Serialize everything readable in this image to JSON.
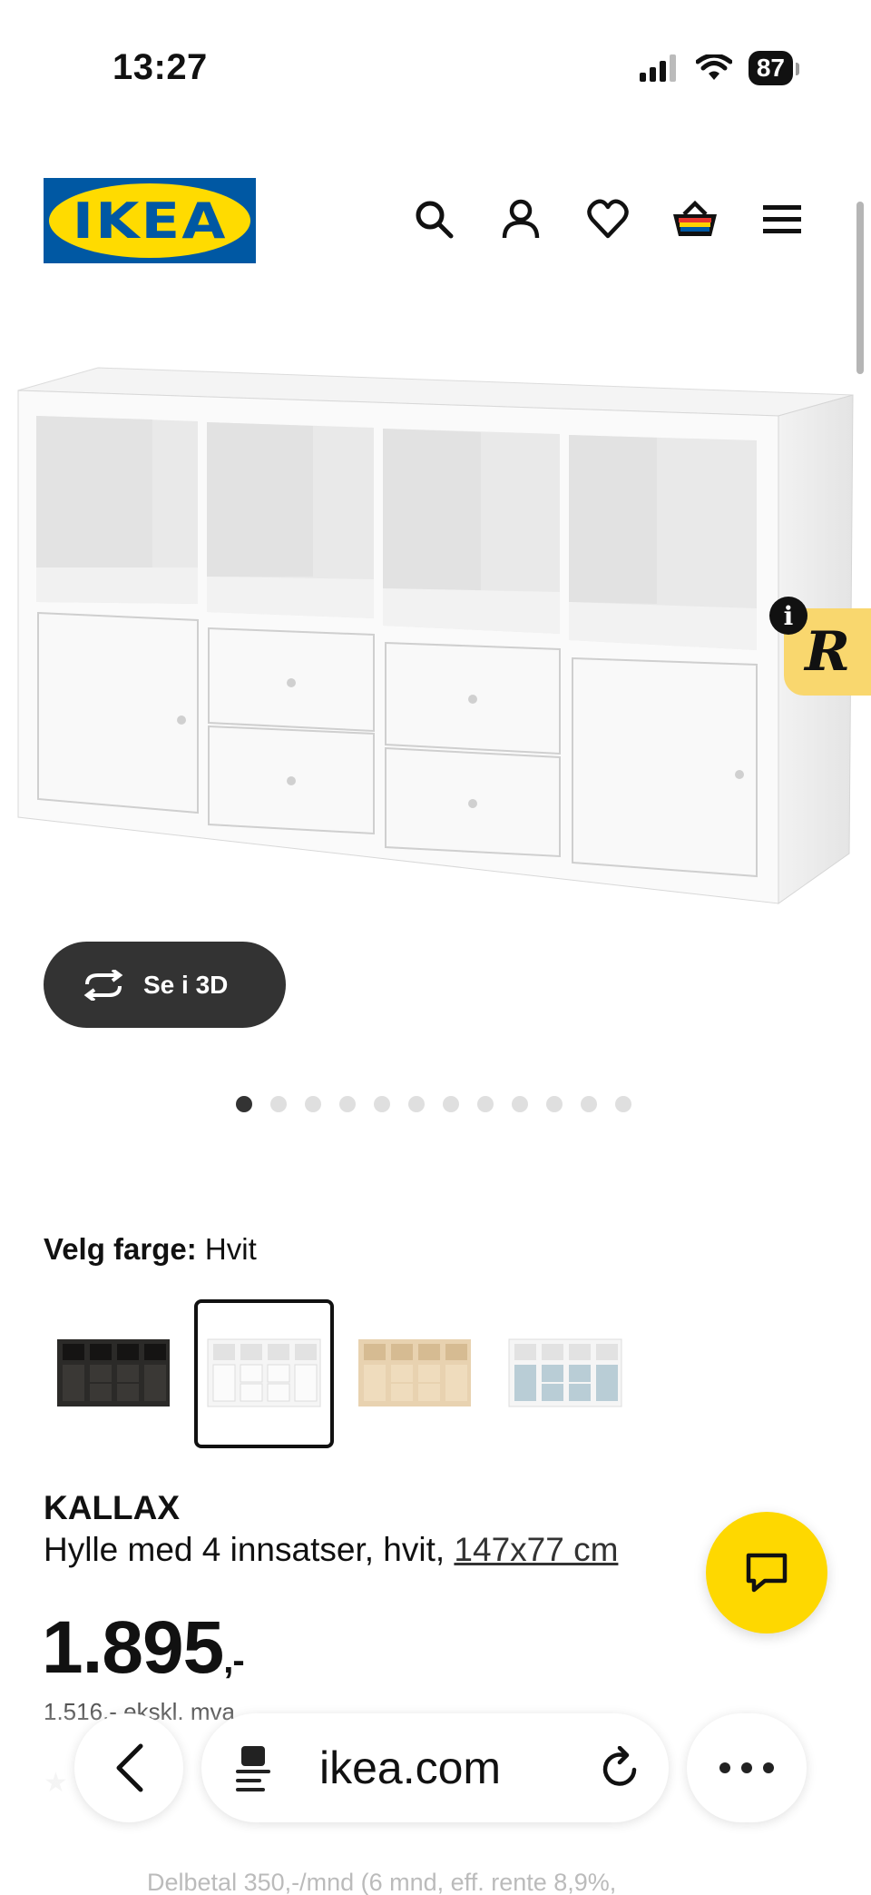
{
  "status_bar": {
    "time": "13:27",
    "battery": "87"
  },
  "header": {
    "logo_text": "IKEA",
    "icons": [
      "search-icon",
      "account-icon",
      "heart-icon",
      "basket-icon",
      "menu-icon"
    ]
  },
  "gallery": {
    "view_3d_label": "Se i 3D",
    "dots_total": 12,
    "active_dot": 1
  },
  "color": {
    "label": "Velg farge:",
    "value": "Hvit",
    "options": [
      "black-brown",
      "white",
      "white-oak",
      "white-blue"
    ],
    "selected_index": 1
  },
  "product": {
    "name": "KALLAX",
    "description": "Hylle med 4 innsatser, hvit,",
    "dimensions": "147x77 cm",
    "price": "1.895",
    "price_suffix": ",-",
    "vat_text": "1.516,- ekskl. mva",
    "installment_text": "Delbetal 350,-/mnd (6 mnd, eff. rente 8,9%,"
  },
  "browser": {
    "url": "ikea.com"
  },
  "colors": {
    "ikea_blue": "#0058a3",
    "ikea_yellow": "#ffdb00",
    "chat_yellow": "#fed800",
    "dark_button": "#333333"
  }
}
